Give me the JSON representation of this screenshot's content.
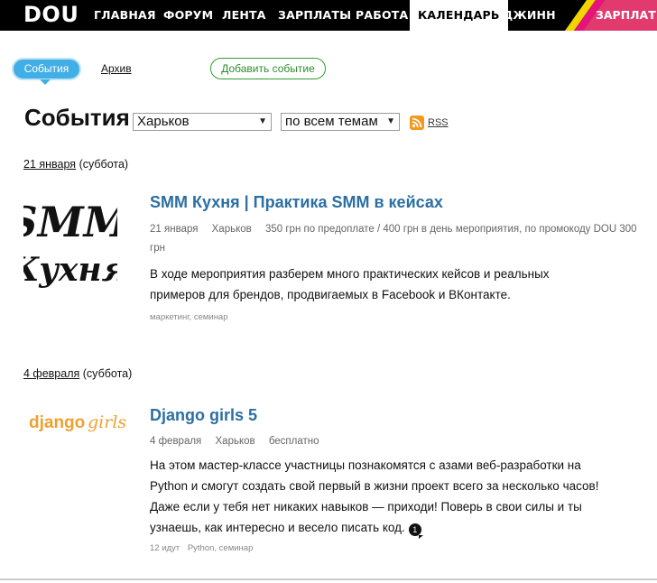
{
  "nav": {
    "logo": "DOU",
    "items": [
      {
        "label": "ГЛАВНАЯ"
      },
      {
        "label": "ФОРУМ"
      },
      {
        "label": "ЛЕНТА"
      },
      {
        "label": "ЗАРПЛАТЫ"
      },
      {
        "label": "РАБОТА"
      },
      {
        "label": "КАЛЕНДАРЬ"
      },
      {
        "label": "ДЖИНН"
      }
    ],
    "promo_label": "ЗАРПЛАТ"
  },
  "subnav": {
    "events": "События",
    "archive": "Архив",
    "add_event": "Добавить событие"
  },
  "heading": {
    "title": "События",
    "city_select": "Харьков",
    "topic_select": "по всем темам",
    "rss": "RSS"
  },
  "groups": [
    {
      "date_link": "21 января",
      "weekday": "(суббота)",
      "event": {
        "image_text_line1": "SMM",
        "image_text_line2": "Кухня",
        "title": "SMM Кухня | Практика SMM в кейсах",
        "date": "21 января",
        "city": "Харьков",
        "price": "350 грн по предоплате / 400 грн в день мероприятия, по промокоду DOU 300 грн",
        "description": "В ходе мероприятия разберем много практических кейсов и реальных примеров для брендов, продвигаемых в Facebook и ВКонтакте.",
        "tags": "маркетинг, семинар"
      }
    },
    {
      "date_link": "4 февраля",
      "weekday": "(суббота)",
      "event": {
        "image_text_part1": "django",
        "image_text_part2": "girls",
        "title": "Django girls 5",
        "date": "4 февраля",
        "city": "Харьков",
        "price": "бесплатно",
        "description": "На этом мастер-классе участницы познакомятся с азами веб-разработки на Python и смогут создать свой первый в жизни проект всего за несколько часов! Даже если у тебя нет никаких навыков — приходи! Поверь в свои силы и ты узнаешь, как интересно и весело писать код.",
        "comments": "1",
        "attendees": "12 идут",
        "tags": "Python, семинар"
      }
    }
  ],
  "colors": {
    "nav_bg": "#000000",
    "accent_blue": "#42aee6",
    "title_blue": "#2b6fa3",
    "add_green": "#2b8f2b",
    "rss_orange": "#f39a1e",
    "django_orange": "#f0a030"
  }
}
